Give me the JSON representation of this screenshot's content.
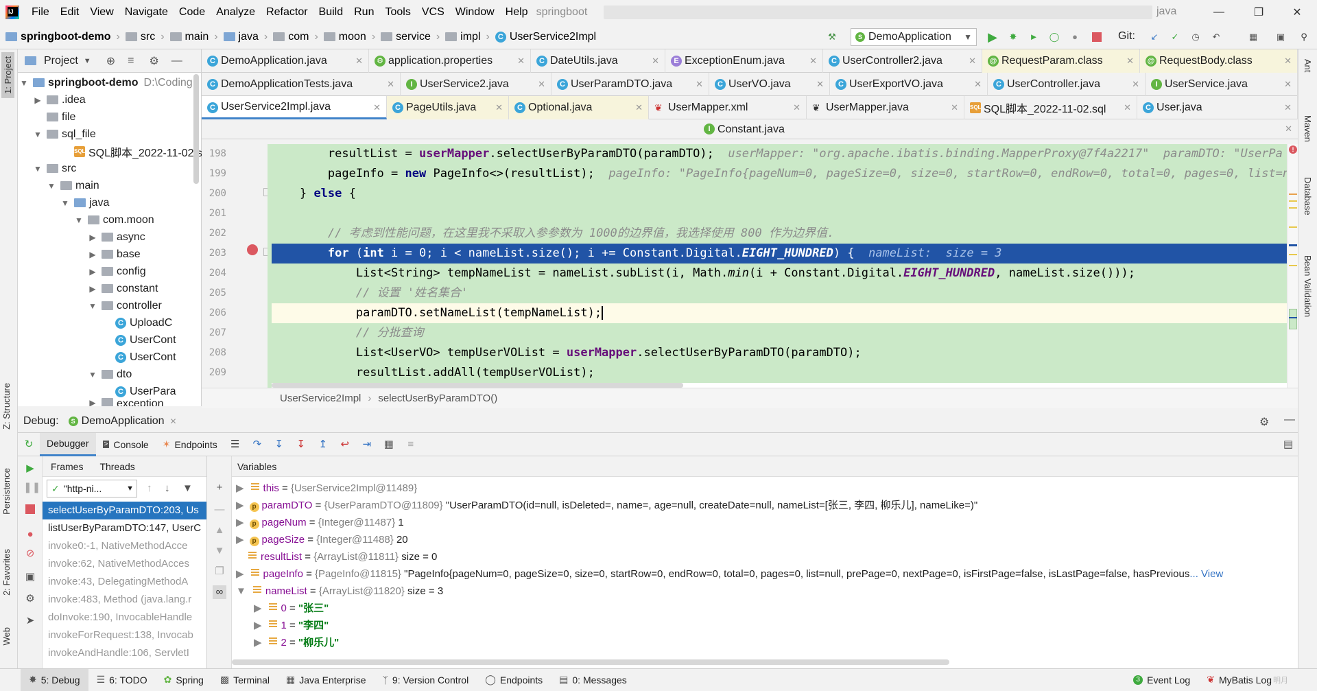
{
  "menu": {
    "items": [
      "File",
      "Edit",
      "View",
      "Navigate",
      "Code",
      "Analyze",
      "Refactor",
      "Build",
      "Run",
      "Tools",
      "VCS",
      "Window",
      "Help"
    ],
    "title_left": "springboot",
    "title_right": "java"
  },
  "navbar": {
    "crumbs": [
      "springboot-demo",
      "src",
      "main",
      "java",
      "com",
      "moon",
      "service",
      "impl",
      "UserService2Impl"
    ],
    "run_config": "DemoApplication",
    "git_label": "Git:"
  },
  "project": {
    "header": "Project",
    "root_name": "springboot-demo",
    "root_path": "D:\\Coding",
    "items": [
      ".idea",
      "file",
      "sql_file",
      "SQL脚本_2022-11-02.sq",
      "src",
      "main",
      "java",
      "com.moon",
      "async",
      "base",
      "config",
      "constant",
      "controller",
      "UploadC",
      "UserCont",
      "UserCont",
      "dto",
      "UserPara",
      "exception"
    ]
  },
  "tabs": {
    "row1": [
      "DemoApplication.java",
      "application.properties",
      "DateUtils.java",
      "ExceptionEnum.java",
      "UserController2.java",
      "RequestParam.class",
      "RequestBody.class"
    ],
    "row2": [
      "DemoApplicationTests.java",
      "UserService2.java",
      "UserParamDTO.java",
      "UserVO.java",
      "UserExportVO.java",
      "UserController.java",
      "UserService.java"
    ],
    "row3": [
      "UserService2Impl.java",
      "PageUtils.java",
      "Optional.java",
      "UserMapper.xml",
      "UserMapper.java",
      "SQL脚本_2022-11-02.sql",
      "User.java"
    ],
    "row4": [
      "Constant.java"
    ]
  },
  "editor": {
    "line_numbers": [
      "198",
      "199",
      "200",
      "201",
      "202",
      "203",
      "204",
      "205",
      "206",
      "207",
      "208",
      "209"
    ],
    "lines": {
      "l198_a": "resultList",
      "l198_b": " = ",
      "l198_c": "userMapper",
      "l198_d": ".selectUserByParamDTO(paramDTO);",
      "l198_hint": "userMapper: \"org.apache.ibatis.binding.MapperProxy@7f4a2217\"  paramDTO: \"UserPa",
      "l199_a": "pageInfo",
      "l199_b": " = ",
      "l199_c": "new",
      "l199_d": " PageInfo<>(",
      "l199_e": "resultList",
      "l199_f": ");",
      "l199_hint": "pageInfo: \"PageInfo{pageNum=0, pageSize=0, size=0, startRow=0, endRow=0, total=0, pages=0, list=n",
      "l200_a": "} ",
      "l200_b": "else",
      "l200_c": " {",
      "l202": "// 考虑到性能问题，在这里我不采取入参参数为 1000的边界值，我选择使用 800 作为边界值.",
      "l203_for": "for",
      "l203_a": " (",
      "l203_int": "int",
      "l203_b": " i = 0; i < nameList.size(); i += Constant.Digital.",
      "l203_c": "EIGHT_HUNDRED",
      "l203_d": ") {",
      "l203_hint": "nameList:  size = 3",
      "l204_a": "List<String> tempNameList = nameList.subList(i, Math.",
      "l204_b": "min",
      "l204_c": "(i + Constant.Digital.",
      "l204_d": "EIGHT_HUNDRED",
      "l204_e": ", nameList.size()));",
      "l205": "// 设置 '姓名集合'",
      "l206": "paramDTO.setNameList(tempNameList);",
      "l207": "// 分批查询",
      "l208_a": "List<UserVO> tempUserVOList = ",
      "l208_b": "userMapper",
      "l208_c": ".selectUserByParamDTO(paramDTO);",
      "l209_a": "resultList",
      "l209_b": ".addAll(tempUserVOList);"
    },
    "breadcrumb": [
      "UserService2Impl",
      "selectUserByParamDTO()"
    ]
  },
  "debug": {
    "label": "Debug:",
    "config": "DemoApplication",
    "tabs": [
      "Debugger",
      "Console",
      "Endpoints"
    ],
    "frames_tab": "Frames",
    "threads_tab": "Threads",
    "thread_select": "\"http-ni...",
    "variables_label": "Variables",
    "frames": [
      "selectUserByParamDTO:203, Us",
      "listUserByParamDTO:147, UserC",
      "invoke0:-1, NativeMethodAcce",
      "invoke:62, NativeMethodAcces",
      "invoke:43, DelegatingMethodA",
      "invoke:483, Method (java.lang.r",
      "doInvoke:190, InvocableHandle",
      "invokeForRequest:138, Invocab",
      "invokeAndHandle:106, ServletI"
    ],
    "vars": {
      "this_n": "this",
      "this_t": "{UserService2Impl@11489}",
      "paramDTO_n": "paramDTO",
      "paramDTO_t": "{UserParamDTO@11809}",
      "paramDTO_v": "\"UserParamDTO(id=null, isDeleted=, name=, age=null, createDate=null, nameList=[张三, 李四, 柳乐儿], nameLike=)\"",
      "pageNum_n": "pageNum",
      "pageNum_t": "{Integer@11487}",
      "pageNum_v": "1",
      "pageSize_n": "pageSize",
      "pageSize_t": "{Integer@11488}",
      "pageSize_v": "20",
      "resultList_n": "resultList",
      "resultList_t": "{ArrayList@11811}",
      "resultList_v": "size = 0",
      "pageInfo_n": "pageInfo",
      "pageInfo_t": "{PageInfo@11815}",
      "pageInfo_v": "\"PageInfo{pageNum=0, pageSize=0, size=0, startRow=0, endRow=0, total=0, pages=0, list=null, prePage=0, nextPage=0, isFirstPage=false, isLastPage=false, hasPrevious",
      "pageInfo_more": "... View",
      "nameList_n": "nameList",
      "nameList_t": "{ArrayList@11820}",
      "nameList_v": "size = 3",
      "e0_n": "0",
      "e0_v": "\"张三\"",
      "e1_n": "1",
      "e1_v": "\"李四\"",
      "e2_n": "2",
      "e2_v": "\"柳乐儿\""
    }
  },
  "left_stripe": [
    "1: Project",
    "Z: Structure",
    "Persistence",
    "2: Favorites",
    "Web"
  ],
  "right_stripe": [
    "Ant",
    "Maven",
    "Database",
    "Bean Validation"
  ],
  "statusbar": {
    "items": [
      "5: Debug",
      "6: TODO",
      "Spring",
      "Terminal",
      "Java Enterprise",
      "9: Version Control",
      "Endpoints",
      "0: Messages"
    ],
    "right": [
      "Event Log",
      "MyBatis Log"
    ],
    "watermark": "明月"
  },
  "colors": {
    "accent": "#4083c9",
    "exec_line": "#2154a6",
    "diff_green": "#cbe9c8",
    "current_line": "#fefbe8"
  }
}
